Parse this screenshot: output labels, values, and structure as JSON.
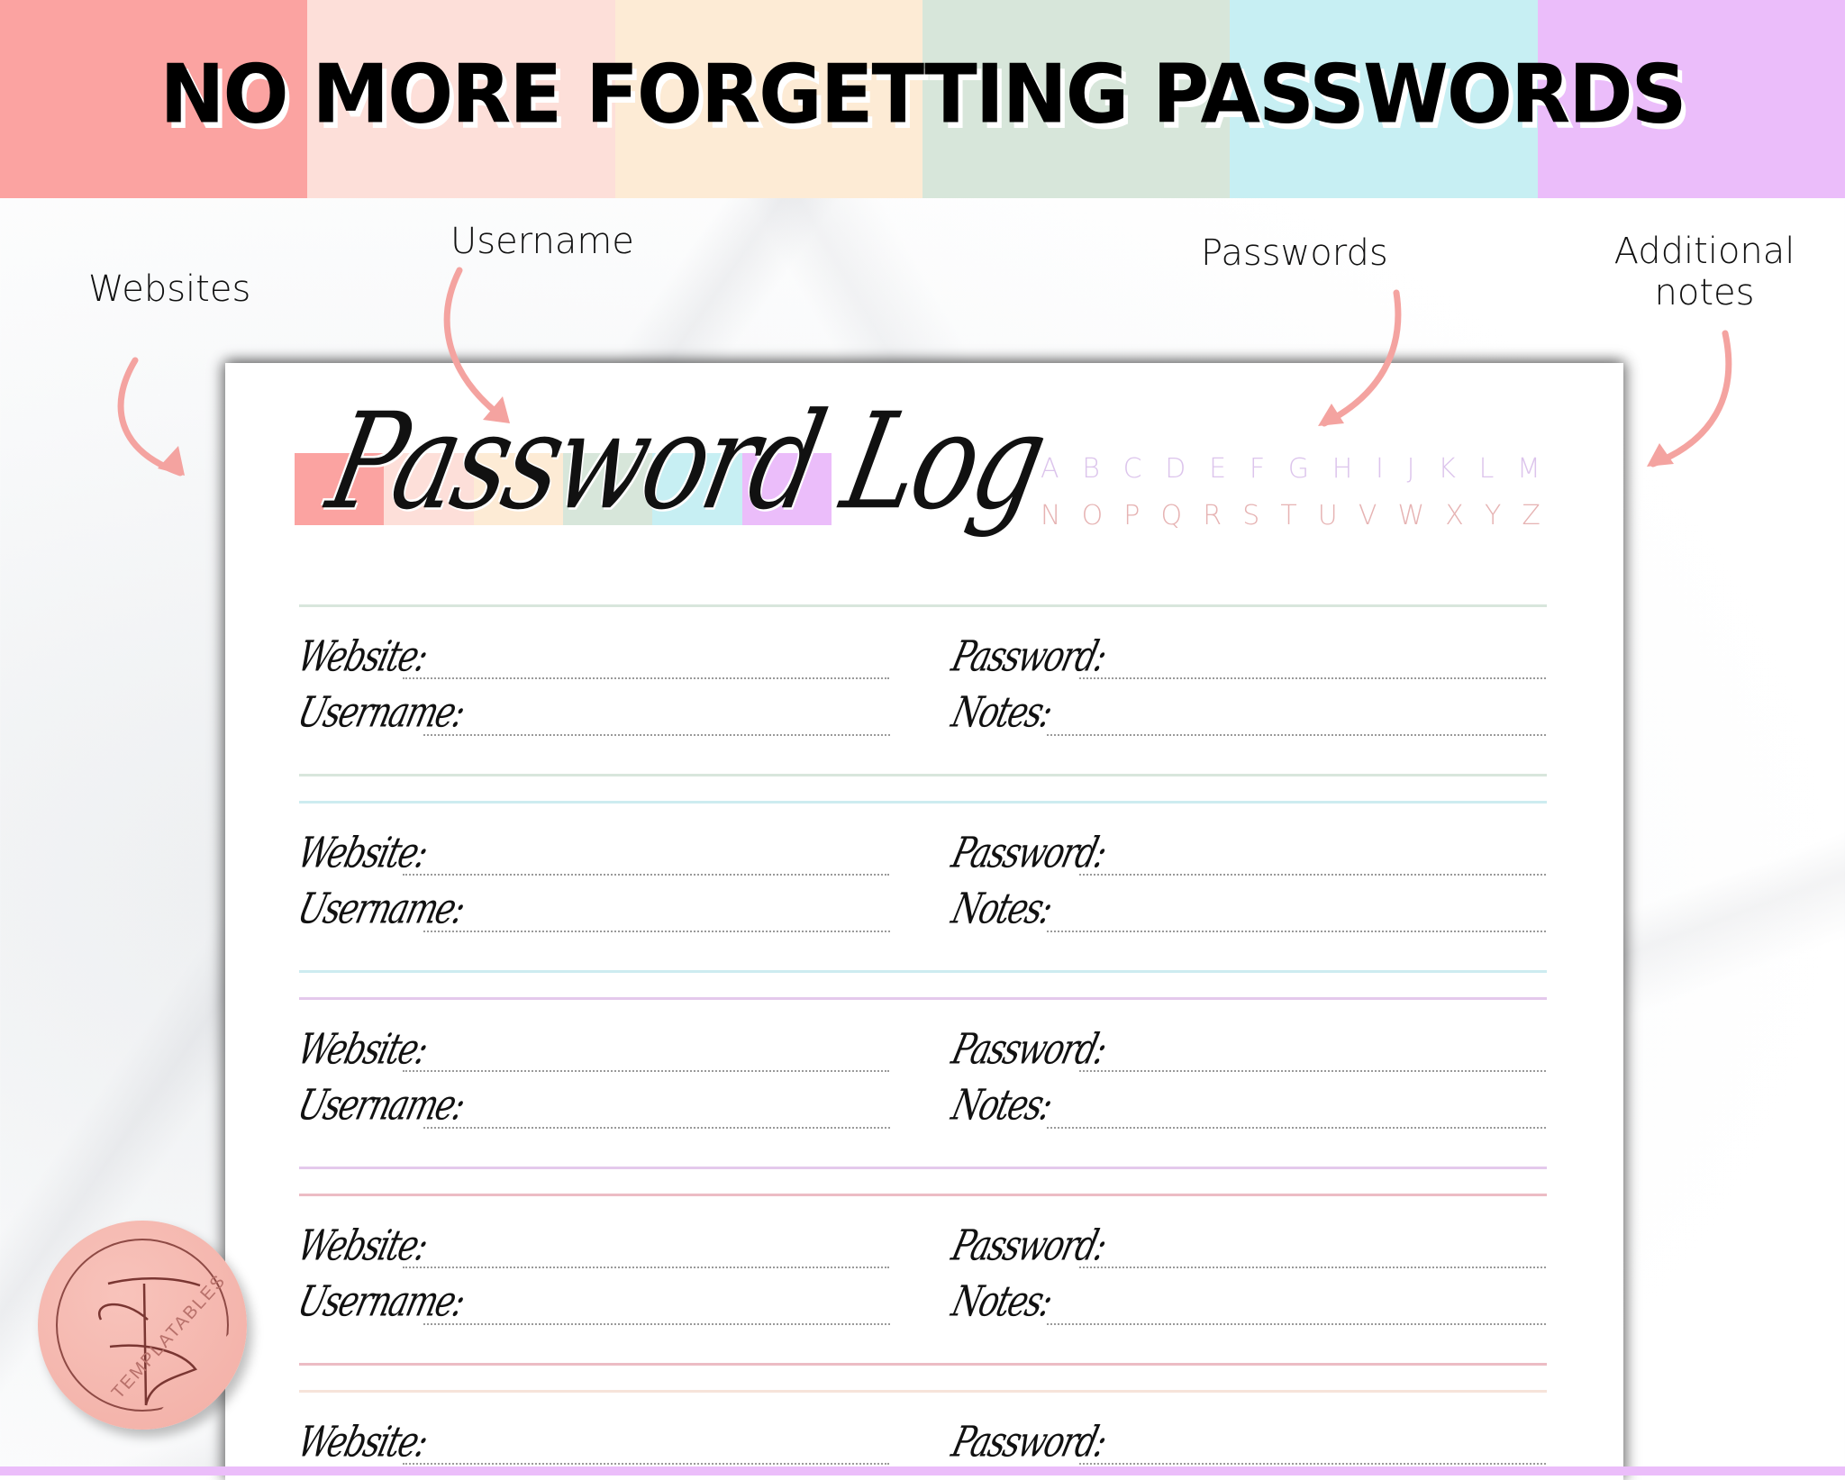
{
  "palette": {
    "coral": "#fba3a1",
    "blush": "#fddfd9",
    "cream": "#fdebd5",
    "sage": "#d7e6da",
    "sky": "#c7eff3",
    "lavender": "#ebbdfa",
    "arrow": "#f4a3a0",
    "alpha_top": "#dcc4ec",
    "alpha_bottom": "#e6b3b3"
  },
  "header": {
    "headline": "NO MORE FORGETTING PASSWORDS"
  },
  "callouts": {
    "websites": "Websites",
    "username": "Username",
    "passwords": "Passwords",
    "additional_notes_line1": "Additional",
    "additional_notes_line2": "notes"
  },
  "page": {
    "title": "Password Log",
    "alphabet_row1": [
      "A",
      "B",
      "C",
      "D",
      "E",
      "F",
      "G",
      "H",
      "I",
      "J",
      "K",
      "L",
      "M"
    ],
    "alphabet_row2": [
      "N",
      "O",
      "P",
      "Q",
      "R",
      "S",
      "T",
      "U",
      "V",
      "W",
      "X",
      "Y",
      "Z"
    ],
    "labels": {
      "website": "Website:",
      "username": "Username:",
      "password": "Password:",
      "notes": "Notes:"
    },
    "entries": [
      {
        "color": "#d8e6dc"
      },
      {
        "color": "#cdecf0"
      },
      {
        "color": "#e4c9ec"
      },
      {
        "color": "#ecbcc4"
      },
      {
        "color": "#f6e3da"
      }
    ]
  },
  "badge": {
    "brand": "TEMPLATABLES",
    "monogram": "TF"
  }
}
